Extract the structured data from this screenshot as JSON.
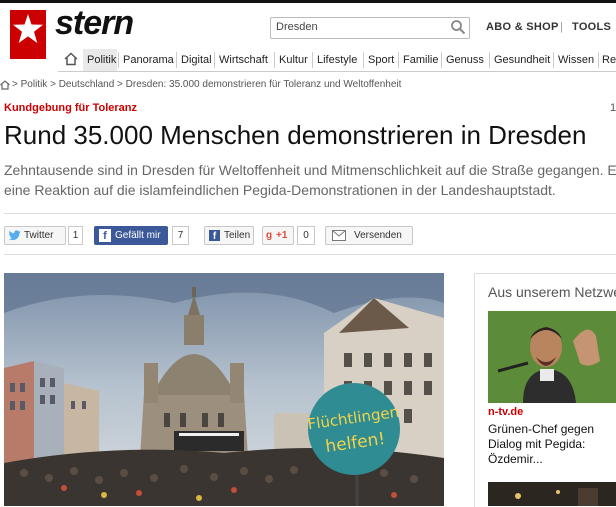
{
  "header": {
    "logo_text": "stern",
    "search_value": "Dresden",
    "abo_label": "ABO & SHOP",
    "separator": "|",
    "tools_label": "TOOLS"
  },
  "nav": {
    "items": [
      "Politik",
      "Panorama",
      "Digital",
      "Wirtschaft",
      "Kultur",
      "Lifestyle",
      "Sport",
      "Familie",
      "Genuss",
      "Gesundheit",
      "Wissen",
      "Re"
    ]
  },
  "breadcrumb": "> Politik > Deutschland > Dresden: 35.000 demonstrieren für Toleranz und Weltoffenheit",
  "article": {
    "kicker": "Kundgebung für Toleranz",
    "date_fragment": "1",
    "headline": "Rund 35.000 Menschen demonstrieren in Dresden",
    "teaser": "Zehntausende sind in Dresden für Weltoffenheit und Mitmenschlichkeit auf die Straße gegangen. Es ist eine Reaktion auf die islamfeindlichen Pegida-Demonstrationen in der Landeshauptstadt."
  },
  "share": {
    "twitter_label": "Twitter",
    "twitter_count": "1",
    "facebook_like_label": "Gefällt mir",
    "facebook_like_count": "7",
    "facebook_share_label": "Teilen",
    "gplus_label": "+1",
    "gplus_count": "0",
    "mail_label": "Versenden"
  },
  "image": {
    "sign_line1": "Flüchtlingen",
    "sign_line2": "helfen!"
  },
  "sidebar": {
    "title": "Aus unserem Netzwerk",
    "source": "n-tv.de",
    "headline": "Grünen-Chef gegen Dialog mit Pegida: Özdemir..."
  },
  "colors": {
    "brand_red": "#cc0000",
    "facebook_blue": "#3b5998",
    "twitter_blue": "#55acee",
    "gplus_red": "#dd4b39"
  }
}
